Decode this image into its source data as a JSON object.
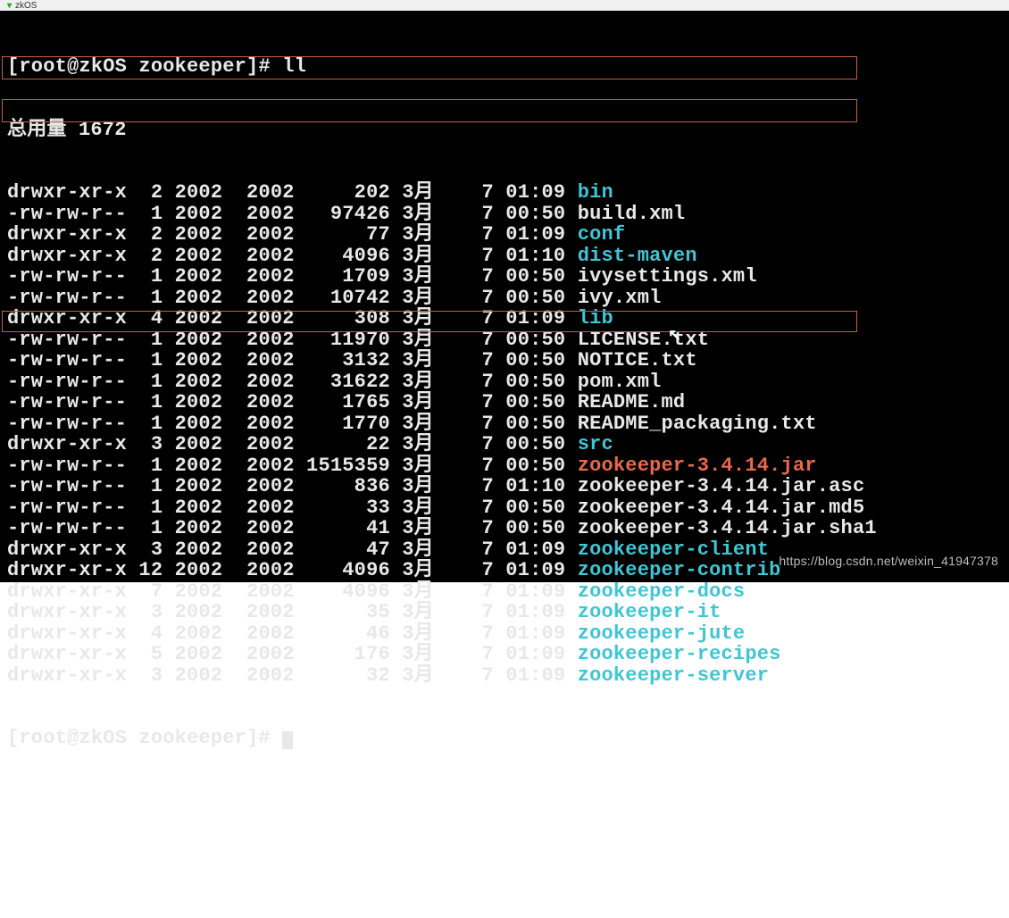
{
  "tab": "zkOS",
  "prompt_top": "[root@zkOS zookeeper]# ll",
  "total_line": "总用量 1672",
  "files": [
    {
      "perm": "drwxr-xr-x",
      "links": " 2",
      "user": "2002",
      "group": "2002",
      "size": "    202",
      "month": "3月",
      "day": "  7",
      "time": "01:09",
      "name": "bin",
      "type": "dir"
    },
    {
      "perm": "-rw-rw-r--",
      "links": " 1",
      "user": "2002",
      "group": "2002",
      "size": "  97426",
      "month": "3月",
      "day": "  7",
      "time": "00:50",
      "name": "build.xml",
      "type": "file"
    },
    {
      "perm": "drwxr-xr-x",
      "links": " 2",
      "user": "2002",
      "group": "2002",
      "size": "     77",
      "month": "3月",
      "day": "  7",
      "time": "01:09",
      "name": "conf",
      "type": "dir"
    },
    {
      "perm": "drwxr-xr-x",
      "links": " 2",
      "user": "2002",
      "group": "2002",
      "size": "   4096",
      "month": "3月",
      "day": "  7",
      "time": "01:10",
      "name": "dist-maven",
      "type": "dir"
    },
    {
      "perm": "-rw-rw-r--",
      "links": " 1",
      "user": "2002",
      "group": "2002",
      "size": "   1709",
      "month": "3月",
      "day": "  7",
      "time": "00:50",
      "name": "ivysettings.xml",
      "type": "file"
    },
    {
      "perm": "-rw-rw-r--",
      "links": " 1",
      "user": "2002",
      "group": "2002",
      "size": "  10742",
      "month": "3月",
      "day": "  7",
      "time": "00:50",
      "name": "ivy.xml",
      "type": "file"
    },
    {
      "perm": "drwxr-xr-x",
      "links": " 4",
      "user": "2002",
      "group": "2002",
      "size": "    308",
      "month": "3月",
      "day": "  7",
      "time": "01:09",
      "name": "lib",
      "type": "dir"
    },
    {
      "perm": "-rw-rw-r--",
      "links": " 1",
      "user": "2002",
      "group": "2002",
      "size": "  11970",
      "month": "3月",
      "day": "  7",
      "time": "00:50",
      "name": "LICENSE.txt",
      "type": "file"
    },
    {
      "perm": "-rw-rw-r--",
      "links": " 1",
      "user": "2002",
      "group": "2002",
      "size": "   3132",
      "month": "3月",
      "day": "  7",
      "time": "00:50",
      "name": "NOTICE.txt",
      "type": "file"
    },
    {
      "perm": "-rw-rw-r--",
      "links": " 1",
      "user": "2002",
      "group": "2002",
      "size": "  31622",
      "month": "3月",
      "day": "  7",
      "time": "00:50",
      "name": "pom.xml",
      "type": "file"
    },
    {
      "perm": "-rw-rw-r--",
      "links": " 1",
      "user": "2002",
      "group": "2002",
      "size": "   1765",
      "month": "3月",
      "day": "  7",
      "time": "00:50",
      "name": "README.md",
      "type": "file"
    },
    {
      "perm": "-rw-rw-r--",
      "links": " 1",
      "user": "2002",
      "group": "2002",
      "size": "   1770",
      "month": "3月",
      "day": "  7",
      "time": "00:50",
      "name": "README_packaging.txt",
      "type": "file"
    },
    {
      "perm": "drwxr-xr-x",
      "links": " 3",
      "user": "2002",
      "group": "2002",
      "size": "     22",
      "month": "3月",
      "day": "  7",
      "time": "00:50",
      "name": "src",
      "type": "dir"
    },
    {
      "perm": "-rw-rw-r--",
      "links": " 1",
      "user": "2002",
      "group": "2002",
      "size": "1515359",
      "month": "3月",
      "day": "  7",
      "time": "00:50",
      "name": "zookeeper-3.4.14.jar",
      "type": "exe"
    },
    {
      "perm": "-rw-rw-r--",
      "links": " 1",
      "user": "2002",
      "group": "2002",
      "size": "    836",
      "month": "3月",
      "day": "  7",
      "time": "01:10",
      "name": "zookeeper-3.4.14.jar.asc",
      "type": "file"
    },
    {
      "perm": "-rw-rw-r--",
      "links": " 1",
      "user": "2002",
      "group": "2002",
      "size": "     33",
      "month": "3月",
      "day": "  7",
      "time": "00:50",
      "name": "zookeeper-3.4.14.jar.md5",
      "type": "file"
    },
    {
      "perm": "-rw-rw-r--",
      "links": " 1",
      "user": "2002",
      "group": "2002",
      "size": "     41",
      "month": "3月",
      "day": "  7",
      "time": "00:50",
      "name": "zookeeper-3.4.14.jar.sha1",
      "type": "file"
    },
    {
      "perm": "drwxr-xr-x",
      "links": " 3",
      "user": "2002",
      "group": "2002",
      "size": "     47",
      "month": "3月",
      "day": "  7",
      "time": "01:09",
      "name": "zookeeper-client",
      "type": "dir"
    },
    {
      "perm": "drwxr-xr-x",
      "links": "12",
      "user": "2002",
      "group": "2002",
      "size": "   4096",
      "month": "3月",
      "day": "  7",
      "time": "01:09",
      "name": "zookeeper-contrib",
      "type": "dir"
    },
    {
      "perm": "drwxr-xr-x",
      "links": " 7",
      "user": "2002",
      "group": "2002",
      "size": "   4096",
      "month": "3月",
      "day": "  7",
      "time": "01:09",
      "name": "zookeeper-docs",
      "type": "dir"
    },
    {
      "perm": "drwxr-xr-x",
      "links": " 3",
      "user": "2002",
      "group": "2002",
      "size": "     35",
      "month": "3月",
      "day": "  7",
      "time": "01:09",
      "name": "zookeeper-it",
      "type": "dir"
    },
    {
      "perm": "drwxr-xr-x",
      "links": " 4",
      "user": "2002",
      "group": "2002",
      "size": "     46",
      "month": "3月",
      "day": "  7",
      "time": "01:09",
      "name": "zookeeper-jute",
      "type": "dir"
    },
    {
      "perm": "drwxr-xr-x",
      "links": " 5",
      "user": "2002",
      "group": "2002",
      "size": "    176",
      "month": "3月",
      "day": "  7",
      "time": "01:09",
      "name": "zookeeper-recipes",
      "type": "dir"
    },
    {
      "perm": "drwxr-xr-x",
      "links": " 3",
      "user": "2002",
      "group": "2002",
      "size": "     32",
      "month": "3月",
      "day": "  7",
      "time": "01:09",
      "name": "zookeeper-server",
      "type": "dir"
    }
  ],
  "prompt_bottom": "[root@zkOS zookeeper]# ",
  "watermark": "https://blog.csdn.net/weixin_41947378"
}
